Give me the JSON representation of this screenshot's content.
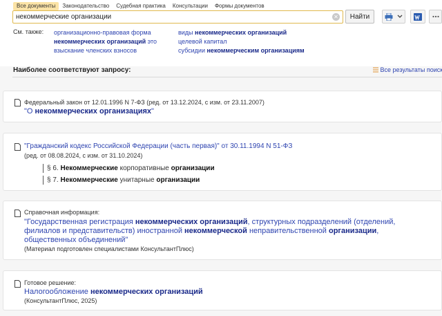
{
  "tabs": [
    {
      "label": "Все документы",
      "active": true
    },
    {
      "label": "Законодательство",
      "active": false
    },
    {
      "label": "Судебная практика",
      "active": false
    },
    {
      "label": "Консультации",
      "active": false
    },
    {
      "label": "Формы документов",
      "active": false
    }
  ],
  "search": {
    "value": "некоммерческие организации",
    "button_label": "Найти"
  },
  "see_also": {
    "label": "См. также:",
    "col1": [
      {
        "pre": "организационно-правовая форма",
        "bold": "",
        "post": ""
      },
      {
        "pre": "",
        "bold": "некоммерческих организаций",
        "post": " это"
      },
      {
        "pre": "взыскание членских взносов",
        "bold": "",
        "post": ""
      }
    ],
    "col2": [
      {
        "pre": "виды ",
        "bold": "некоммерческих организаций",
        "post": ""
      },
      {
        "pre": "целевой капитал",
        "bold": "",
        "post": ""
      },
      {
        "pre": "субсидии ",
        "bold": "некоммерческим организациям",
        "post": ""
      }
    ]
  },
  "results_heading": "Наиболее соответствуют запросу:",
  "all_results_label": "Все результаты поиска",
  "results": {
    "r1": {
      "meta": "Федеральный закон от 12.01.1996 N 7-ФЗ (ред. от 13.12.2024, с изм. от 23.11.2007)",
      "title_pre": "\"О ",
      "title_bold": "некоммерческих организациях",
      "title_post": "\""
    },
    "r2": {
      "title": "\"Гражданский кодекс Российской Федерации (часть первая)\"",
      "title_post": " от 30.11.1994 N 51-ФЗ",
      "meta": "(ред. от 08.08.2024, с изм. от 31.10.2024)",
      "sub1": {
        "num": "§ 6. ",
        "b1": "Некоммерческие",
        "mid": " корпоративные ",
        "b2": "организации"
      },
      "sub2": {
        "num": "§ 7. ",
        "b1": "Некоммерческие",
        "mid": " унитарные ",
        "b2": "организации"
      }
    },
    "r3": {
      "label": "Справочная информация:",
      "l1_pre": "\"Государственная регистрация ",
      "l1_bold": "некоммерческих организаций",
      "l1_post": ", структурных подразделений (отделений,",
      "l2_pre": "филиалов и представительств) иностранной ",
      "l2_bold1": "некоммерческой",
      "l2_mid": " неправительственной ",
      "l2_bold2": "организации",
      "l2_post": ",",
      "l3": "общественных объединений\"",
      "note": "(Материал подготовлен специалистами КонсультантПлюс)"
    },
    "r4": {
      "label": "Готовое решение:",
      "title_pre": "Налогообложение ",
      "title_bold": "некоммерческих организаций",
      "note": "(КонсультантПлюс, 2025)"
    }
  },
  "colors": {
    "link": "#2e44b0",
    "tab_active": "#fbe3a6",
    "accent": "#e0b84c"
  },
  "icons": [
    "clear-icon",
    "printer-icon",
    "dropdown-arrow-icon",
    "word-icon",
    "more-icon",
    "list-icon",
    "document-icon"
  ]
}
